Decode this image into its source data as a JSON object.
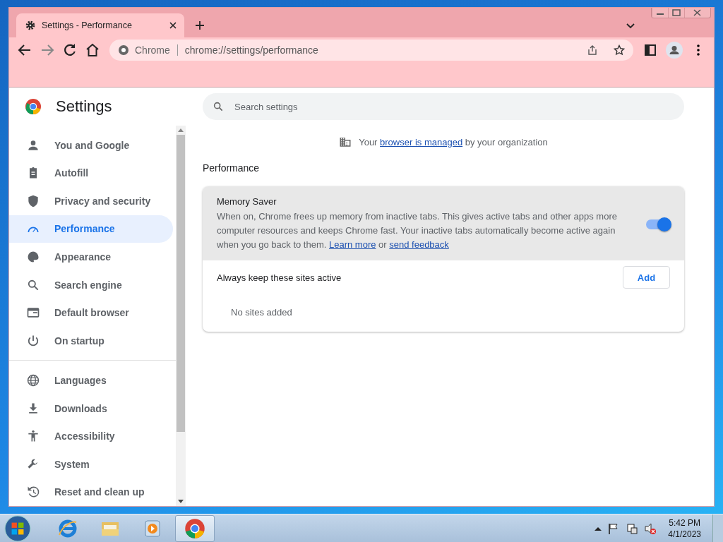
{
  "tabs": [
    {
      "title": "Settings - Performance",
      "selected": true
    }
  ],
  "address": {
    "chip": "Chrome",
    "url": "chrome://settings/performance"
  },
  "settings_title": "Settings",
  "search": {
    "placeholder": "Search settings"
  },
  "sidebar": {
    "groups": [
      [
        {
          "label": "You and Google",
          "selected": false
        },
        {
          "label": "Autofill",
          "selected": false
        },
        {
          "label": "Privacy and security",
          "selected": false
        },
        {
          "label": "Performance",
          "selected": true
        },
        {
          "label": "Appearance",
          "selected": false
        },
        {
          "label": "Search engine",
          "selected": false
        },
        {
          "label": "Default browser",
          "selected": false
        },
        {
          "label": "On startup",
          "selected": false
        }
      ],
      [
        {
          "label": "Languages",
          "selected": false
        },
        {
          "label": "Downloads",
          "selected": false
        },
        {
          "label": "Accessibility",
          "selected": false
        },
        {
          "label": "System",
          "selected": false
        },
        {
          "label": "Reset and clean up",
          "selected": false
        }
      ]
    ]
  },
  "managed_notice": {
    "before": "Your",
    "link": "browser is managed",
    "after": "by your organization"
  },
  "section_title": "Performance",
  "memory_saver": {
    "title": "Memory Saver",
    "description": "When on, Chrome frees up memory from inactive tabs. This gives active tabs and other apps more computer resources and keeps Chrome fast. Your inactive tabs automatically become active again when you go back to them.",
    "learn_more": "Learn more",
    "joiner": "or",
    "feedback": "send feedback",
    "on": true
  },
  "keep_active": {
    "label": "Always keep these sites active",
    "button": "Add",
    "empty": "No sites added"
  },
  "taskbar": {
    "apps": [
      {
        "selected": false
      },
      {
        "selected": false
      },
      {
        "selected": false
      },
      {
        "selected": true
      }
    ],
    "time": "5:42 PM",
    "date": "4/1/2023"
  }
}
